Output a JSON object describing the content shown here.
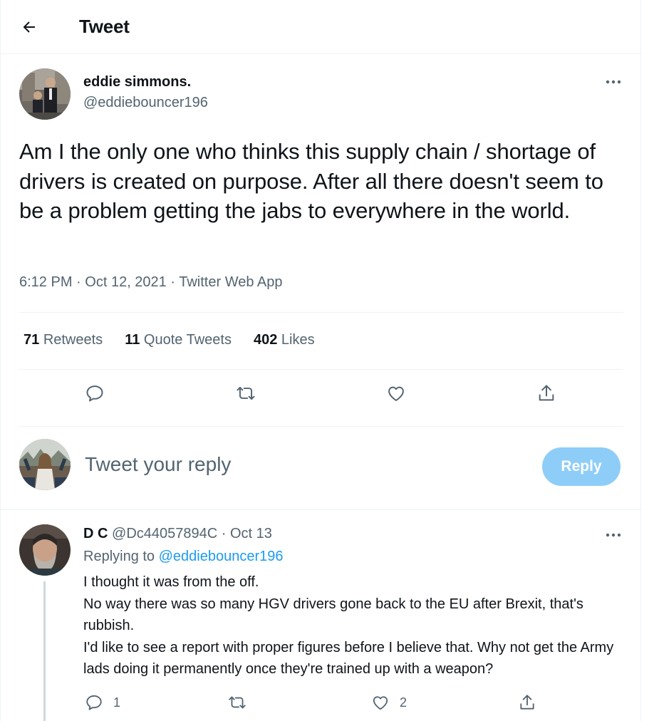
{
  "header": {
    "title": "Tweet",
    "back_icon": "arrow-left-icon"
  },
  "tweet": {
    "author_name": "eddie simmons.",
    "author_handle": "@eddiebouncer196",
    "text": "Am I the only one who thinks this supply chain / shortage of drivers is created on purpose. After all there doesn't seem to be a problem getting the jabs to everywhere in the world.",
    "time": "6:12 PM",
    "date": "Oct 12, 2021",
    "source": "Twitter Web App",
    "sep": "·",
    "stats": {
      "retweets_count": "71",
      "retweets_label": "Retweets",
      "quotes_count": "11",
      "quotes_label": "Quote Tweets",
      "likes_count": "402",
      "likes_label": "Likes"
    }
  },
  "compose": {
    "placeholder": "Tweet your reply",
    "button_label": "Reply"
  },
  "reply": {
    "name": "D C",
    "handle": "@Dc44057894C",
    "sep": "·",
    "date": "Oct 13",
    "replying_label": "Replying to",
    "replying_to": "@eddiebouncer196",
    "lines": [
      "I thought it was from the off.",
      "No way there was so many HGV drivers gone back to the EU after Brexit, that's rubbish.",
      "I'd like to see a report with proper figures before I believe that. Why not get the Army lads doing it permanently once they're trained up with a weapon?"
    ],
    "reply_count": "1",
    "like_count": "2"
  },
  "colors": {
    "accent": "#1d9bf0",
    "reply_button": "#8ecdf8",
    "secondary_text": "#536471",
    "text": "#0f1419"
  }
}
